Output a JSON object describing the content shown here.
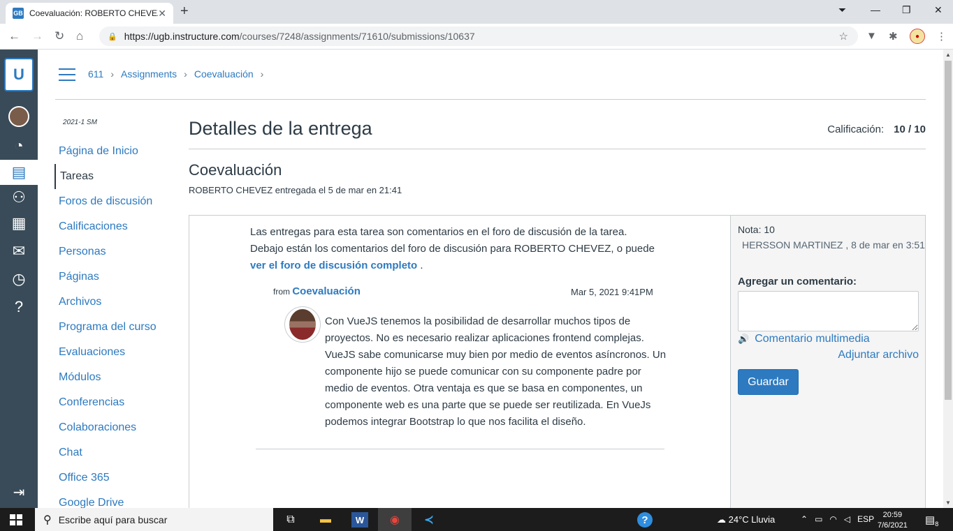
{
  "browser": {
    "tab_title": "Coevaluación: ROBERTO CHEVEZ",
    "favicon_text": "GB",
    "url_host": "https://ugb.instructure.com",
    "url_path": "/courses/7248/assignments/71610/submissions/10637"
  },
  "breadcrumbs": [
    "611",
    "Assignments",
    "Coevaluación"
  ],
  "course_nav": {
    "term": "2021-1 SM",
    "items": [
      {
        "label": "Página de Inicio",
        "active": false
      },
      {
        "label": "Tareas",
        "active": true
      },
      {
        "label": "Foros de discusión",
        "active": false
      },
      {
        "label": "Calificaciones",
        "active": false
      },
      {
        "label": "Personas",
        "active": false
      },
      {
        "label": "Páginas",
        "active": false
      },
      {
        "label": "Archivos",
        "active": false
      },
      {
        "label": "Programa del curso",
        "active": false
      },
      {
        "label": "Evaluaciones",
        "active": false
      },
      {
        "label": "Módulos",
        "active": false
      },
      {
        "label": "Conferencias",
        "active": false
      },
      {
        "label": "Colaboraciones",
        "active": false
      },
      {
        "label": "Chat",
        "active": false
      },
      {
        "label": "Office 365",
        "active": false
      },
      {
        "label": "Google Drive",
        "active": false
      }
    ]
  },
  "page": {
    "title": "Detalles de la entrega",
    "grade_label": "Calificación:",
    "grade_value": "10 / 10",
    "assignment_title": "Coevaluación",
    "submitter": "ROBERTO CHEVEZ",
    "submitted_text": "entregada el 5 de mar en 21:41"
  },
  "submission": {
    "intro_line1": "Las entregas para esta tarea son comentarios en el foro de discusión de la tarea.",
    "intro_line2": "Debajo están los comentarios del foro de discusión para ROBERTO CHEVEZ, o puede",
    "intro_link": "ver el foro de discusión completo",
    "intro_end": ".",
    "post_from_label": "from",
    "post_from_link": "Coevaluación",
    "post_date": "Mar 5, 2021 9:41PM",
    "post_body": "Con VueJS tenemos la posibilidad de desarrollar muchos tipos de proyectos. No es necesario realizar aplicaciones frontend complejas. VueJS sabe comunicarse muy bien por medio de eventos asíncronos. Un componente hijo se puede comunicar con su componente padre por medio de eventos. Otra ventaja es que se basa en componentes, un componente web es una parte que se puede ser reutilizada. En VueJs podemos integrar Bootstrap lo que nos facilita el diseño."
  },
  "sidebar": {
    "nota": "Nota: 10",
    "nota_by": "HERSSON MARTINEZ , 8 de mar en 3:51",
    "add_comment_label": "Agregar un comentario:",
    "media_comment": "Comentario multimedia",
    "attach_file": "Adjuntar archivo",
    "save_button": "Guardar"
  },
  "taskbar": {
    "search_placeholder": "Escribe aquí para buscar",
    "weather": "24°C  Lluvia",
    "lang": "ESP",
    "time": "20:59",
    "date": "7/6/2021",
    "notif_count": "8"
  },
  "colors": {
    "accent": "#2d7ac0",
    "global_nav": "#394b58",
    "text": "#2d3b45"
  }
}
